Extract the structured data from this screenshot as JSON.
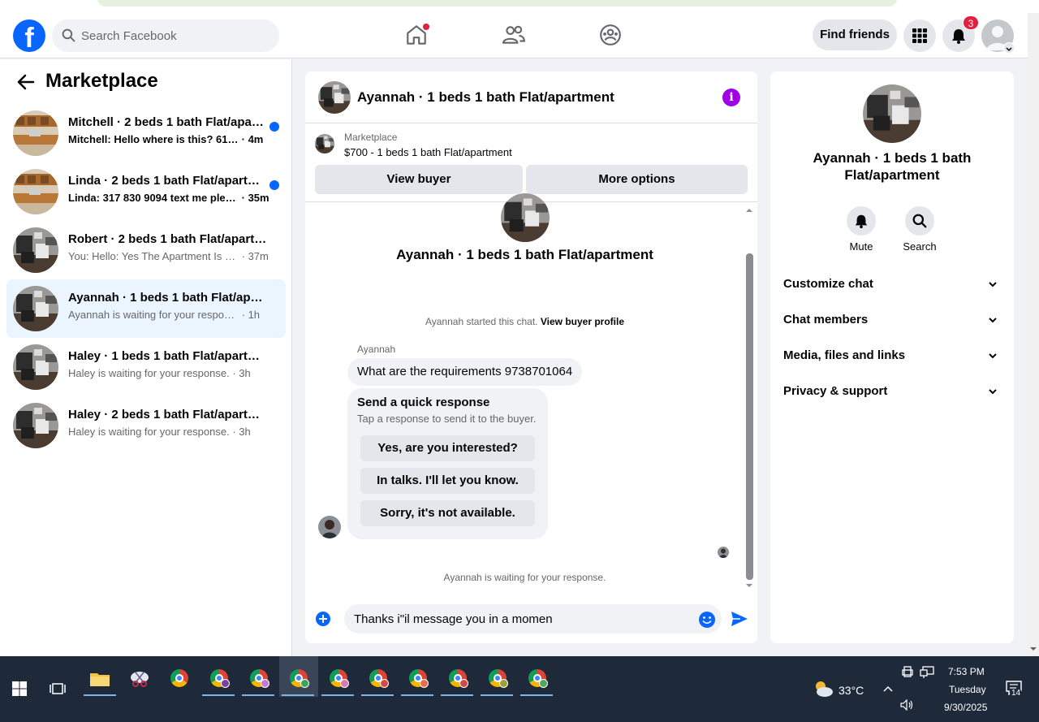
{
  "nav": {
    "search_placeholder": "Search Facebook",
    "find_friends": "Find friends",
    "notification_count": "3",
    "home_icon": "home-icon",
    "friends_icon": "friends-icon",
    "groups_icon": "groups-icon"
  },
  "sidebar": {
    "title": "Marketplace",
    "conversations": [
      {
        "name": "Mitchell · 2 beds 1 bath Flat/apartment",
        "preview": "Mitchell: Hello where is this? 6164...",
        "time": "· 4m",
        "unread": true
      },
      {
        "name": "Linda · 2 beds 1 bath Flat/apartment",
        "preview": "Linda: 317 830 9094 text me plea...",
        "time": "· 35m",
        "unread": true
      },
      {
        "name": "Robert · 2 beds 1 bath Flat/apartment",
        "preview": "You: Hello: Yes The Apartment Is Still...",
        "time": "· 37m",
        "unread": false
      },
      {
        "name": "Ayannah · 1 beds 1 bath Flat/apartment",
        "preview": "Ayannah is waiting for your response.",
        "time": "· 1h",
        "unread": false,
        "active": true
      },
      {
        "name": "Haley · 1 beds 1 bath Flat/apartment",
        "preview": "Haley is waiting for your response.",
        "time": "· 3h",
        "unread": false
      },
      {
        "name": "Haley · 2 beds 1 bath Flat/apartment",
        "preview": "Haley is waiting for your response.",
        "time": "· 3h",
        "unread": false
      }
    ]
  },
  "chat": {
    "title": "Ayannah · 1 beds 1 bath Flat/apartment",
    "listing_label": "Marketplace",
    "listing_price": "$700 - 1 beds 1 bath Flat/apartment",
    "view_buyer": "View buyer",
    "more_options": "More options",
    "started_text": "Ayannah started this chat.",
    "view_profile": "View buyer profile",
    "sender": "Ayannah",
    "message": "What are the requirements 9738701064",
    "quick_title": "Send a quick response",
    "quick_subtitle": "Tap a response to send it to the buyer.",
    "quick_options": [
      "Yes, are you interested?",
      "In talks. I'll let you know.",
      "Sorry, it's not available."
    ],
    "waiting": "Ayannah is waiting for your response.",
    "composer_value": "Thanks i\"il message you in a momen"
  },
  "right": {
    "name": "Ayannah · 1 beds 1 bath Flat/apartment",
    "mute": "Mute",
    "search": "Search",
    "sections": [
      "Customize chat",
      "Chat members",
      "Media, files and links",
      "Privacy & support"
    ]
  },
  "taskbar": {
    "temperature": "33°C",
    "time": "7:53 PM",
    "day": "Tuesday",
    "date": "9/30/2025",
    "notifications": "14"
  },
  "colors": {
    "accent": "#0866ff",
    "badge": "#e41e3f",
    "info": "#a200e4"
  }
}
